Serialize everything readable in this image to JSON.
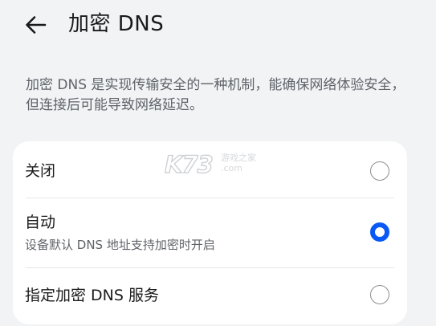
{
  "header": {
    "title": "加密 DNS"
  },
  "description": "加密 DNS 是实现传输安全的一种机制，能确保网络体验安全，但连接后可能导致网络延迟。",
  "options": [
    {
      "label": "关闭",
      "sublabel": "",
      "selected": false
    },
    {
      "label": "自动",
      "sublabel": "设备默认 DNS 地址支持加密时开启",
      "selected": true
    },
    {
      "label": "指定加密 DNS 服务",
      "sublabel": "",
      "selected": false
    }
  ],
  "watermark": {
    "mark": "K73",
    "line1": "游戏之家",
    "line2": ".com"
  },
  "colors": {
    "accent": "#0a59f7",
    "background": "#f1f3f5",
    "card": "#ffffff",
    "secondary_text": "#5f6368"
  }
}
